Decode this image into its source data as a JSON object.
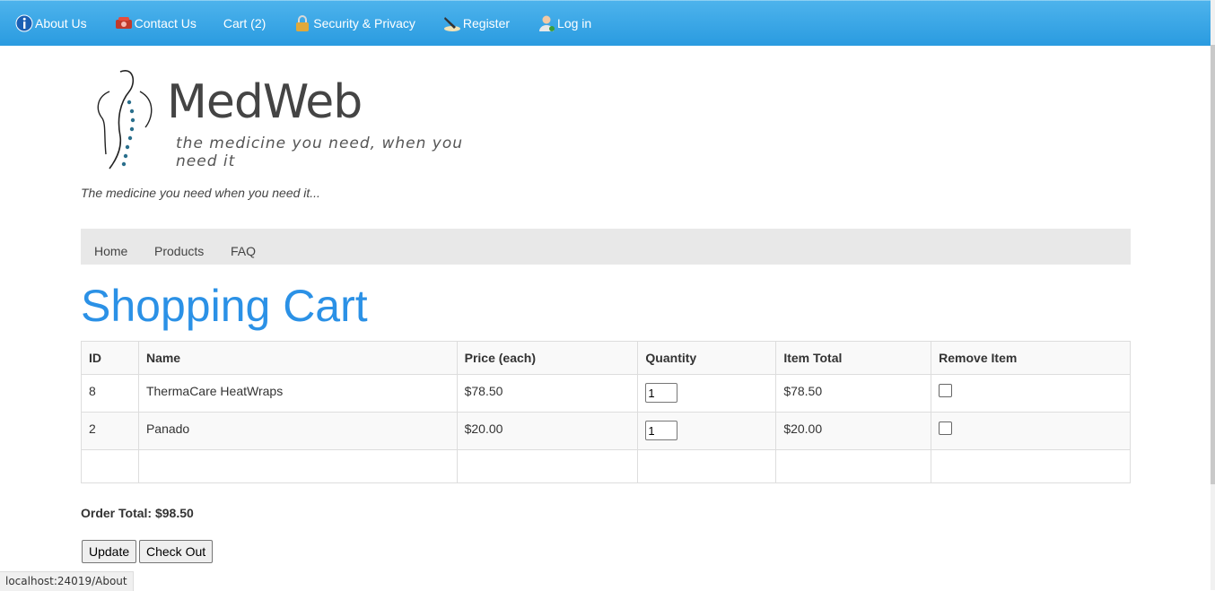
{
  "topnav": {
    "items": [
      {
        "label": "About Us",
        "icon": "info-icon"
      },
      {
        "label": "Contact Us",
        "icon": "phone-icon"
      },
      {
        "label": "Cart (2)",
        "icon": ""
      },
      {
        "label": "Security & Privacy",
        "icon": "lock-icon"
      },
      {
        "label": "Register",
        "icon": "pen-icon"
      },
      {
        "label": "Log in",
        "icon": "user-icon"
      }
    ]
  },
  "logo": {
    "brand": "MedWeb",
    "slogan": "the medicine you need, when you need it"
  },
  "tagline": "The medicine you need when you need it...",
  "subnav": {
    "home": "Home",
    "products": "Products",
    "faq": "FAQ"
  },
  "page_title": "Shopping Cart",
  "table": {
    "headers": [
      "ID",
      "Name",
      "Price (each)",
      "Quantity",
      "Item Total",
      "Remove Item"
    ],
    "rows": [
      {
        "id": "8",
        "name": "ThermaCare HeatWraps",
        "price": "$78.50",
        "quantity": "1",
        "item_total": "$78.50"
      },
      {
        "id": "2",
        "name": "Panado",
        "price": "$20.00",
        "quantity": "1",
        "item_total": "$20.00"
      }
    ]
  },
  "order_total": "Order Total: $98.50",
  "buttons": {
    "update": "Update",
    "checkout": "Check Out"
  },
  "status_bar": "localhost:24019/About",
  "colors": {
    "topbar": "#2a9be0",
    "title": "#2b91e6"
  }
}
